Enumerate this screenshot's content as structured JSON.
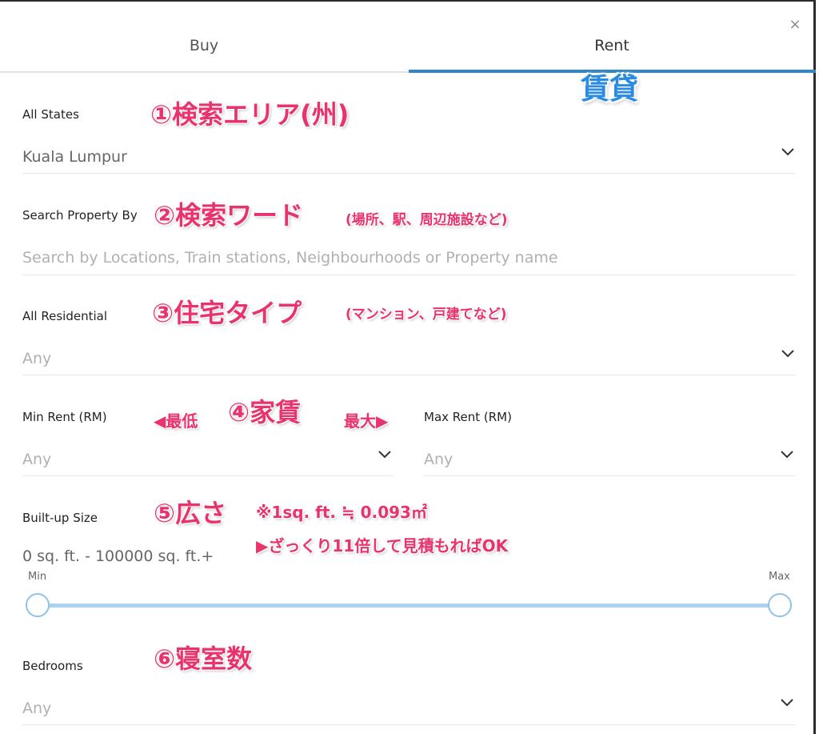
{
  "dialog": {
    "close_icon": "×",
    "tabs": [
      {
        "label": "Buy",
        "active": false
      },
      {
        "label": "Rent",
        "active": true
      }
    ],
    "accent_color": "#2f87c6"
  },
  "fields": {
    "state": {
      "label": "All States",
      "value": "Kuala Lumpur"
    },
    "search": {
      "label": "Search Property By",
      "placeholder": "Search by Locations, Train stations, Neighbourhoods or Property name"
    },
    "residential": {
      "label": "All Residential",
      "value": "Any"
    },
    "min_rent": {
      "label": "Min Rent (RM)",
      "value": "Any"
    },
    "max_rent": {
      "label": "Max Rent (RM)",
      "value": "Any"
    },
    "built_up": {
      "label": "Built-up Size",
      "value": "0 sq. ft. - 100000 sq. ft.+",
      "min_label": "Min",
      "max_label": "Max",
      "range_min": 0,
      "range_max": 100000,
      "selected_min": 0,
      "selected_max": 100000
    },
    "bedrooms": {
      "label": "Bedrooms",
      "value": "Any"
    }
  },
  "annotations": {
    "rent_tab": "賃貸",
    "a1": "①検索エリア(州)",
    "a2": "②検索ワード",
    "a2_note": "(場所、駅、周辺施設など)",
    "a3": "③住宅タイプ",
    "a3_note": "(マンション、戸建てなど)",
    "a4": "④家賃",
    "a4_min": "◀最低",
    "a4_max": "最大▶",
    "a5": "⑤広さ",
    "a5_note1": "※1sq. ft. ≒ 0.093㎡",
    "a5_note2": "▶ざっくり11倍して見積もればOK",
    "a6": "⑥寝室数",
    "annotation_color": "#e8336d",
    "rent_annotation_color": "#2a8be0"
  }
}
